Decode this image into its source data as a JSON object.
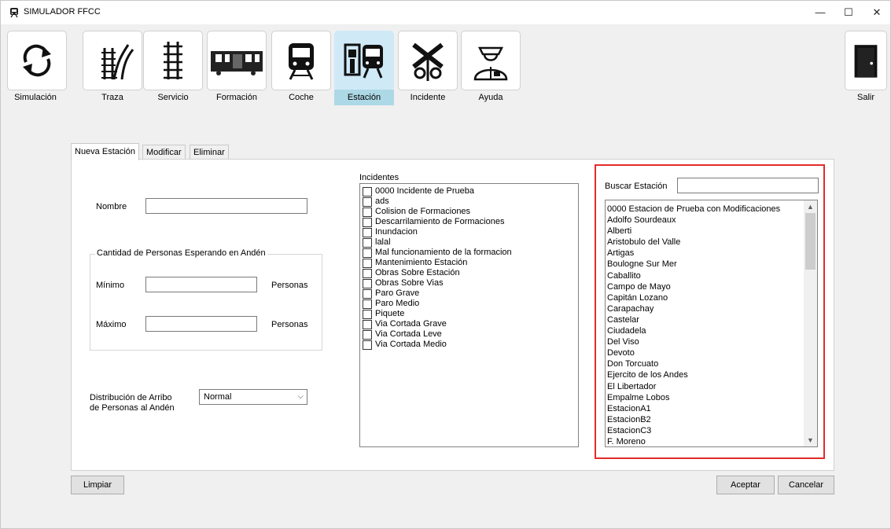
{
  "window": {
    "title": "SIMULADOR FFCC",
    "minimize": "—",
    "maximize": "☐",
    "close": "✕"
  },
  "toolbar": {
    "simulacion": "Simulación",
    "traza": "Traza",
    "servicio": "Servicio",
    "formacion": "Formación",
    "coche": "Coche",
    "estacion": "Estación",
    "incidente": "Incidente",
    "ayuda": "Ayuda",
    "salir": "Salir"
  },
  "tabs": {
    "nueva": "Nueva Estación",
    "modificar": "Modificar",
    "eliminar": "Eliminar"
  },
  "form": {
    "nombre_label": "Nombre",
    "nombre_value": "",
    "group_title": "Cantidad de Personas Esperando en Andén",
    "minimo_label": "Mínimo",
    "minimo_value": "",
    "maximo_label": "Máximo",
    "maximo_value": "",
    "personas_unit": "Personas",
    "distribucion_label_1": "Distribución de Arribo",
    "distribucion_label_2": "de Personas al Andén",
    "distribucion_value": "Normal"
  },
  "incidentes": {
    "label": "Incidentes",
    "items": [
      "0000 Incidente de Prueba",
      "ads",
      "Colision de Formaciones",
      "Descarrilamiento de Formaciones",
      "Inundacion",
      "lalal",
      "Mal funcionamiento de la formacion",
      "Mantenimiento Estación",
      "Obras Sobre Estación",
      "Obras Sobre Vias",
      "Paro Grave",
      "Paro Medio",
      "Piquete",
      "Via Cortada Grave",
      "Via Cortada Leve",
      "Via Cortada Medio"
    ]
  },
  "buscar": {
    "label": "Buscar Estación",
    "value": "",
    "stations": [
      "0000 Estacion de Prueba con Modificaciones",
      "Adolfo Sourdeaux",
      "Alberti",
      "Aristobulo del Valle",
      "Artigas",
      "Boulogne Sur Mer",
      "Caballito",
      "Campo de Mayo",
      "Capitán Lozano",
      "Carapachay",
      "Castelar",
      "Ciudadela",
      "Del Viso",
      "Devoto",
      "Don Torcuato",
      "Ejercito de los Andes",
      "El Libertador",
      "Empalme Lobos",
      "EstacionA1",
      "EstacionB2",
      "EstacionC3",
      "F. Moreno"
    ]
  },
  "buttons": {
    "limpiar": "Limpiar",
    "aceptar": "Aceptar",
    "cancelar": "Cancelar"
  }
}
